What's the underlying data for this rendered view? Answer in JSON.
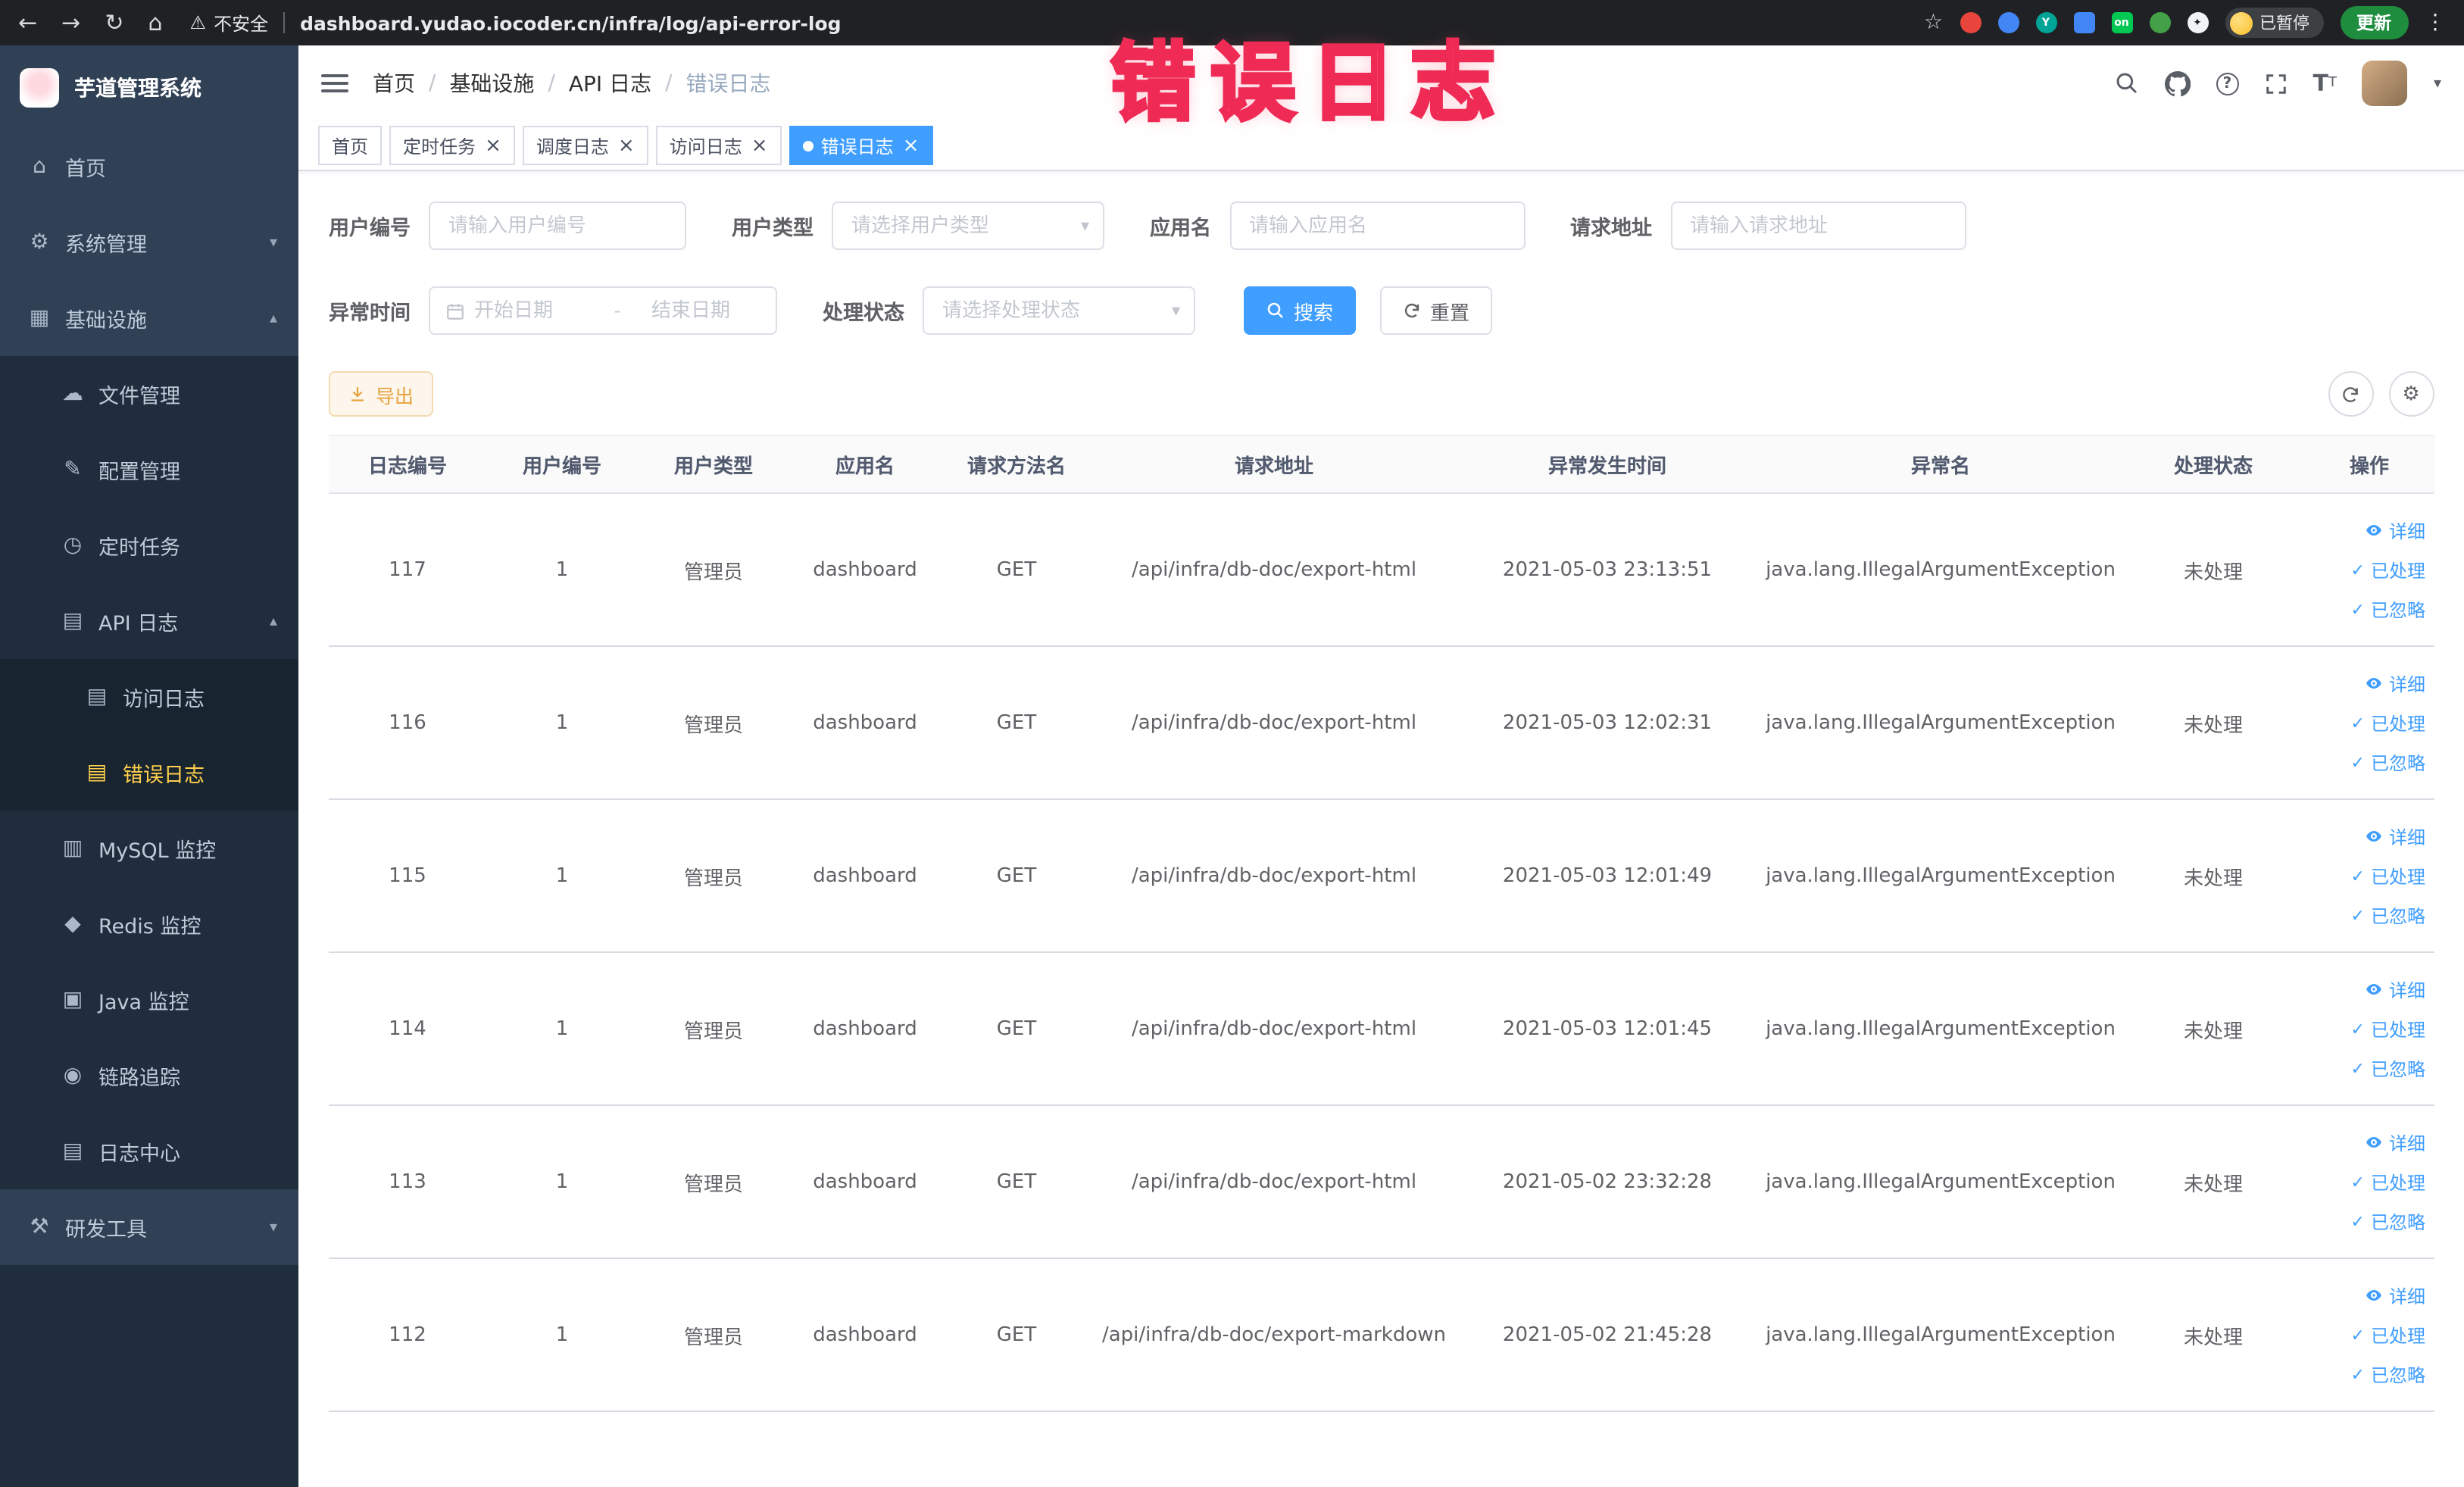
{
  "browser": {
    "security_label": "不安全",
    "url": "dashboard.yudao.iocoder.cn/infra/log/api-error-log",
    "paused_label": "已暂停",
    "update_label": "更新"
  },
  "annotation": {
    "text": "错误日志"
  },
  "sidebar": {
    "title": "芋道管理系统",
    "items": [
      {
        "key": "home",
        "label": "首页",
        "icon": "home",
        "level": 0
      },
      {
        "key": "system-mgmt",
        "label": "系统管理",
        "icon": "gear",
        "level": 0,
        "chevron": "down"
      },
      {
        "key": "infrastructure",
        "label": "基础设施",
        "icon": "grid",
        "level": 0,
        "chevron": "up"
      },
      {
        "key": "file-mgmt",
        "label": "文件管理",
        "icon": "cloud",
        "level": 1
      },
      {
        "key": "config-mgmt",
        "label": "配置管理",
        "icon": "edit",
        "level": 1
      },
      {
        "key": "scheduled-task",
        "label": "定时任务",
        "icon": "clock",
        "level": 1
      },
      {
        "key": "api-log",
        "label": "API 日志",
        "icon": "doc",
        "level": 1,
        "chevron": "up"
      },
      {
        "key": "access-log",
        "label": "访问日志",
        "icon": "doc",
        "level": 2
      },
      {
        "key": "error-log",
        "label": "错误日志",
        "icon": "doc",
        "level": 2,
        "active": true
      },
      {
        "key": "mysql-monitor",
        "label": "MySQL 监控",
        "icon": "db",
        "level": 1
      },
      {
        "key": "redis-monitor",
        "label": "Redis 监控",
        "icon": "diamond",
        "level": 1
      },
      {
        "key": "java-monitor",
        "label": "Java 监控",
        "icon": "monitor",
        "level": 1
      },
      {
        "key": "trace",
        "label": "链路追踪",
        "icon": "eye",
        "level": 1
      },
      {
        "key": "log-center",
        "label": "日志中心",
        "icon": "doc",
        "level": 1
      },
      {
        "key": "dev-tools",
        "label": "研发工具",
        "icon": "tool",
        "level": 0,
        "chevron": "down"
      }
    ]
  },
  "header": {
    "breadcrumb": [
      "首页",
      "基础设施",
      "API 日志",
      "错误日志"
    ]
  },
  "tabs": [
    {
      "label": "首页",
      "closable": false
    },
    {
      "label": "定时任务",
      "closable": true
    },
    {
      "label": "调度日志",
      "closable": true
    },
    {
      "label": "访问日志",
      "closable": true
    },
    {
      "label": "错误日志",
      "closable": true,
      "active": true
    }
  ],
  "filters": {
    "user_id": {
      "label": "用户编号",
      "placeholder": "请输入用户编号"
    },
    "user_type": {
      "label": "用户类型",
      "placeholder": "请选择用户类型"
    },
    "app_name": {
      "label": "应用名",
      "placeholder": "请输入应用名"
    },
    "request_url": {
      "label": "请求地址",
      "placeholder": "请输入请求地址"
    },
    "exception_time": {
      "label": "异常时间",
      "start_placeholder": "开始日期",
      "separator": "-",
      "end_placeholder": "结束日期"
    },
    "process_status": {
      "label": "处理状态",
      "placeholder": "请选择处理状态"
    },
    "search_label": "搜索",
    "reset_label": "重置"
  },
  "toolbar": {
    "export_label": "导出"
  },
  "table": {
    "columns": [
      "日志编号",
      "用户编号",
      "用户类型",
      "应用名",
      "请求方法名",
      "请求地址",
      "异常发生时间",
      "异常名",
      "处理状态",
      "操作"
    ],
    "actions": [
      "详细",
      "已处理",
      "已忽略"
    ],
    "rows": [
      {
        "id": "117",
        "user_id": "1",
        "user_type": "管理员",
        "app": "dashboard",
        "method": "GET",
        "url": "/api/infra/db-doc/export-html",
        "time": "2021-05-03 23:13:51",
        "exception": "java.lang.IllegalArgumentException",
        "status": "未处理"
      },
      {
        "id": "116",
        "user_id": "1",
        "user_type": "管理员",
        "app": "dashboard",
        "method": "GET",
        "url": "/api/infra/db-doc/export-html",
        "time": "2021-05-03 12:02:31",
        "exception": "java.lang.IllegalArgumentException",
        "status": "未处理"
      },
      {
        "id": "115",
        "user_id": "1",
        "user_type": "管理员",
        "app": "dashboard",
        "method": "GET",
        "url": "/api/infra/db-doc/export-html",
        "time": "2021-05-03 12:01:49",
        "exception": "java.lang.IllegalArgumentException",
        "status": "未处理"
      },
      {
        "id": "114",
        "user_id": "1",
        "user_type": "管理员",
        "app": "dashboard",
        "method": "GET",
        "url": "/api/infra/db-doc/export-html",
        "time": "2021-05-03 12:01:45",
        "exception": "java.lang.IllegalArgumentException",
        "status": "未处理"
      },
      {
        "id": "113",
        "user_id": "1",
        "user_type": "管理员",
        "app": "dashboard",
        "method": "GET",
        "url": "/api/infra/db-doc/export-html",
        "time": "2021-05-02 23:32:28",
        "exception": "java.lang.IllegalArgumentException",
        "status": "未处理"
      },
      {
        "id": "112",
        "user_id": "1",
        "user_type": "管理员",
        "app": "dashboard",
        "method": "GET",
        "url": "/api/infra/db-doc/export-markdown",
        "time": "2021-05-02 21:45:28",
        "exception": "java.lang.IllegalArgumentException",
        "status": "未处理"
      }
    ]
  }
}
